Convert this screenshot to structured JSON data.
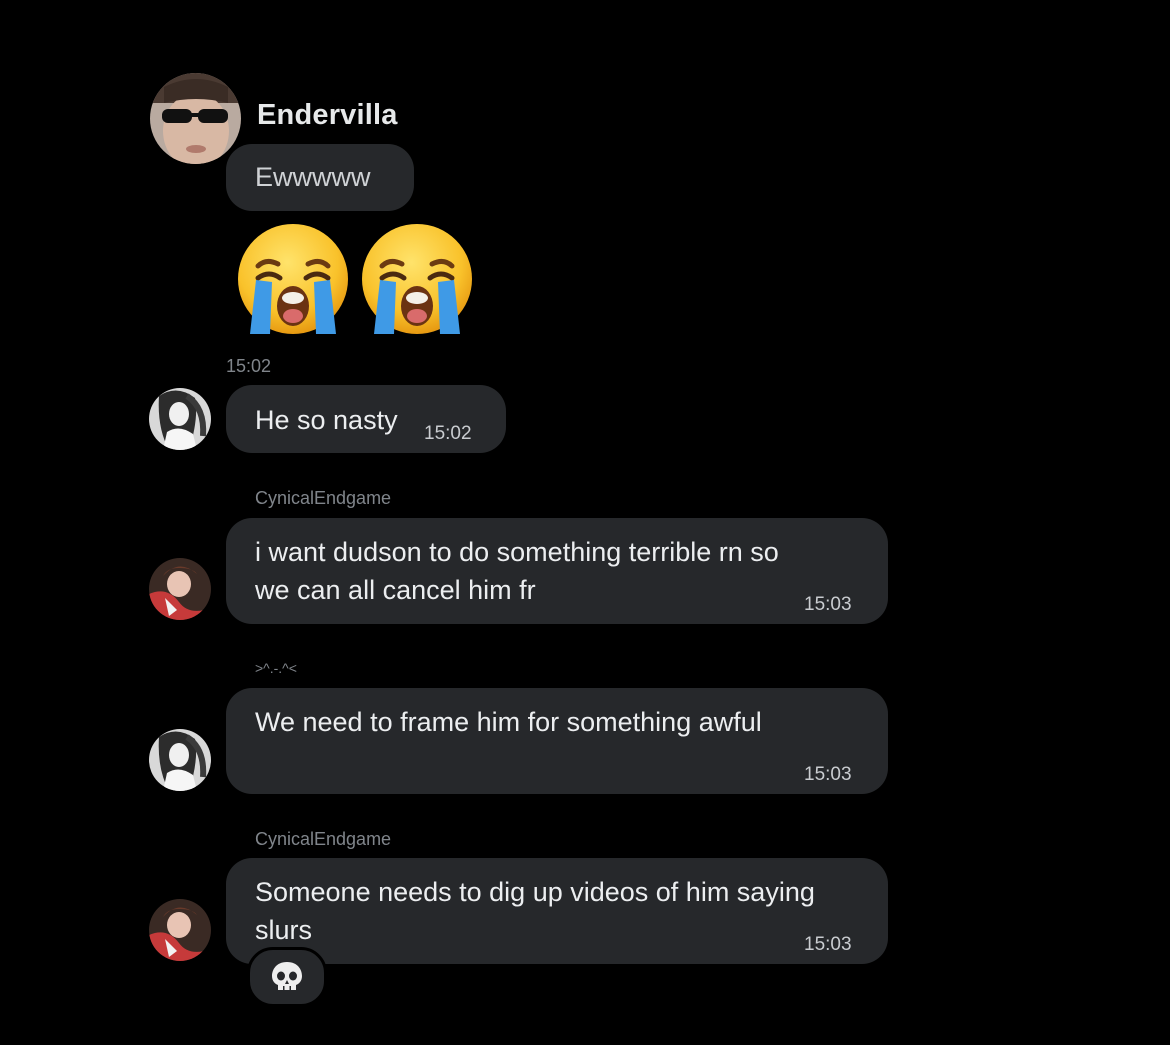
{
  "messages": [
    {
      "sender": "Endervilla",
      "text": "Ewwwww",
      "emoji": [
        "crying-face",
        "crying-face"
      ],
      "time": "15:02"
    },
    {
      "text": "He so nasty",
      "time": "15:02"
    },
    {
      "sender": "CynicalEndgame",
      "text": "i want dudson to do something terrible rn so\nwe can all cancel him fr",
      "time": "15:03"
    },
    {
      "sender": ">^.-.^<",
      "text": "We need to frame him for something awful",
      "time": "15:03"
    },
    {
      "sender": "CynicalEndgame",
      "text": "Someone needs to dig up videos of him saying\nslurs",
      "time": "15:03",
      "reaction": "skull"
    }
  ],
  "colors": {
    "background": "#000000",
    "bubble": "#26282b",
    "text": "#e7e9ea",
    "muted": "#80858b"
  }
}
